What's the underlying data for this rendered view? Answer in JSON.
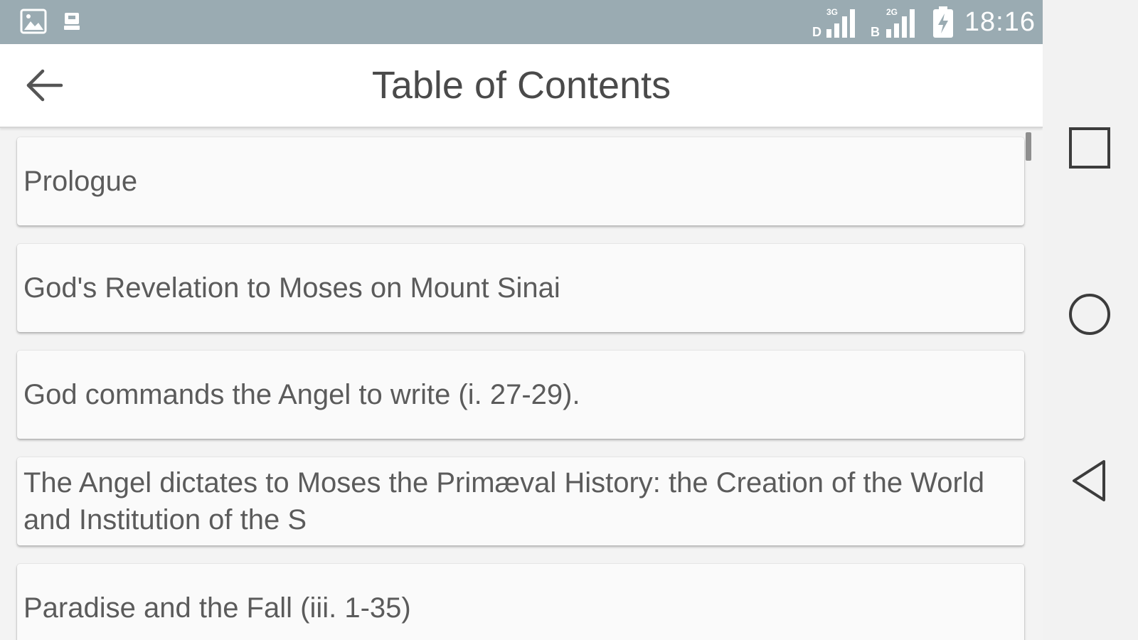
{
  "status_bar": {
    "time": "18:16",
    "left_icons": [
      "image-icon",
      "notification-icon"
    ],
    "right_icons": [
      "signal-3g-icon",
      "signal-2g-icon",
      "battery-icon"
    ],
    "background": "#9aabb2"
  },
  "app_bar": {
    "title": "Table of Contents",
    "back_icon": "arrow-back-icon"
  },
  "toc": {
    "items": [
      {
        "label": "Prologue"
      },
      {
        "label": "God's Revelation to Moses on Mount Sinai"
      },
      {
        "label": "God commands the Angel to write (i. 27-29)."
      },
      {
        "label": "The Angel dictates to Moses the Primæval History: the Creation of the World and Institution of the S"
      },
      {
        "label": "Paradise and the Fall (iii. 1-35)"
      }
    ]
  },
  "nav_bar": {
    "buttons": [
      "recents-square-icon",
      "home-circle-icon",
      "back-triangle-icon"
    ]
  }
}
